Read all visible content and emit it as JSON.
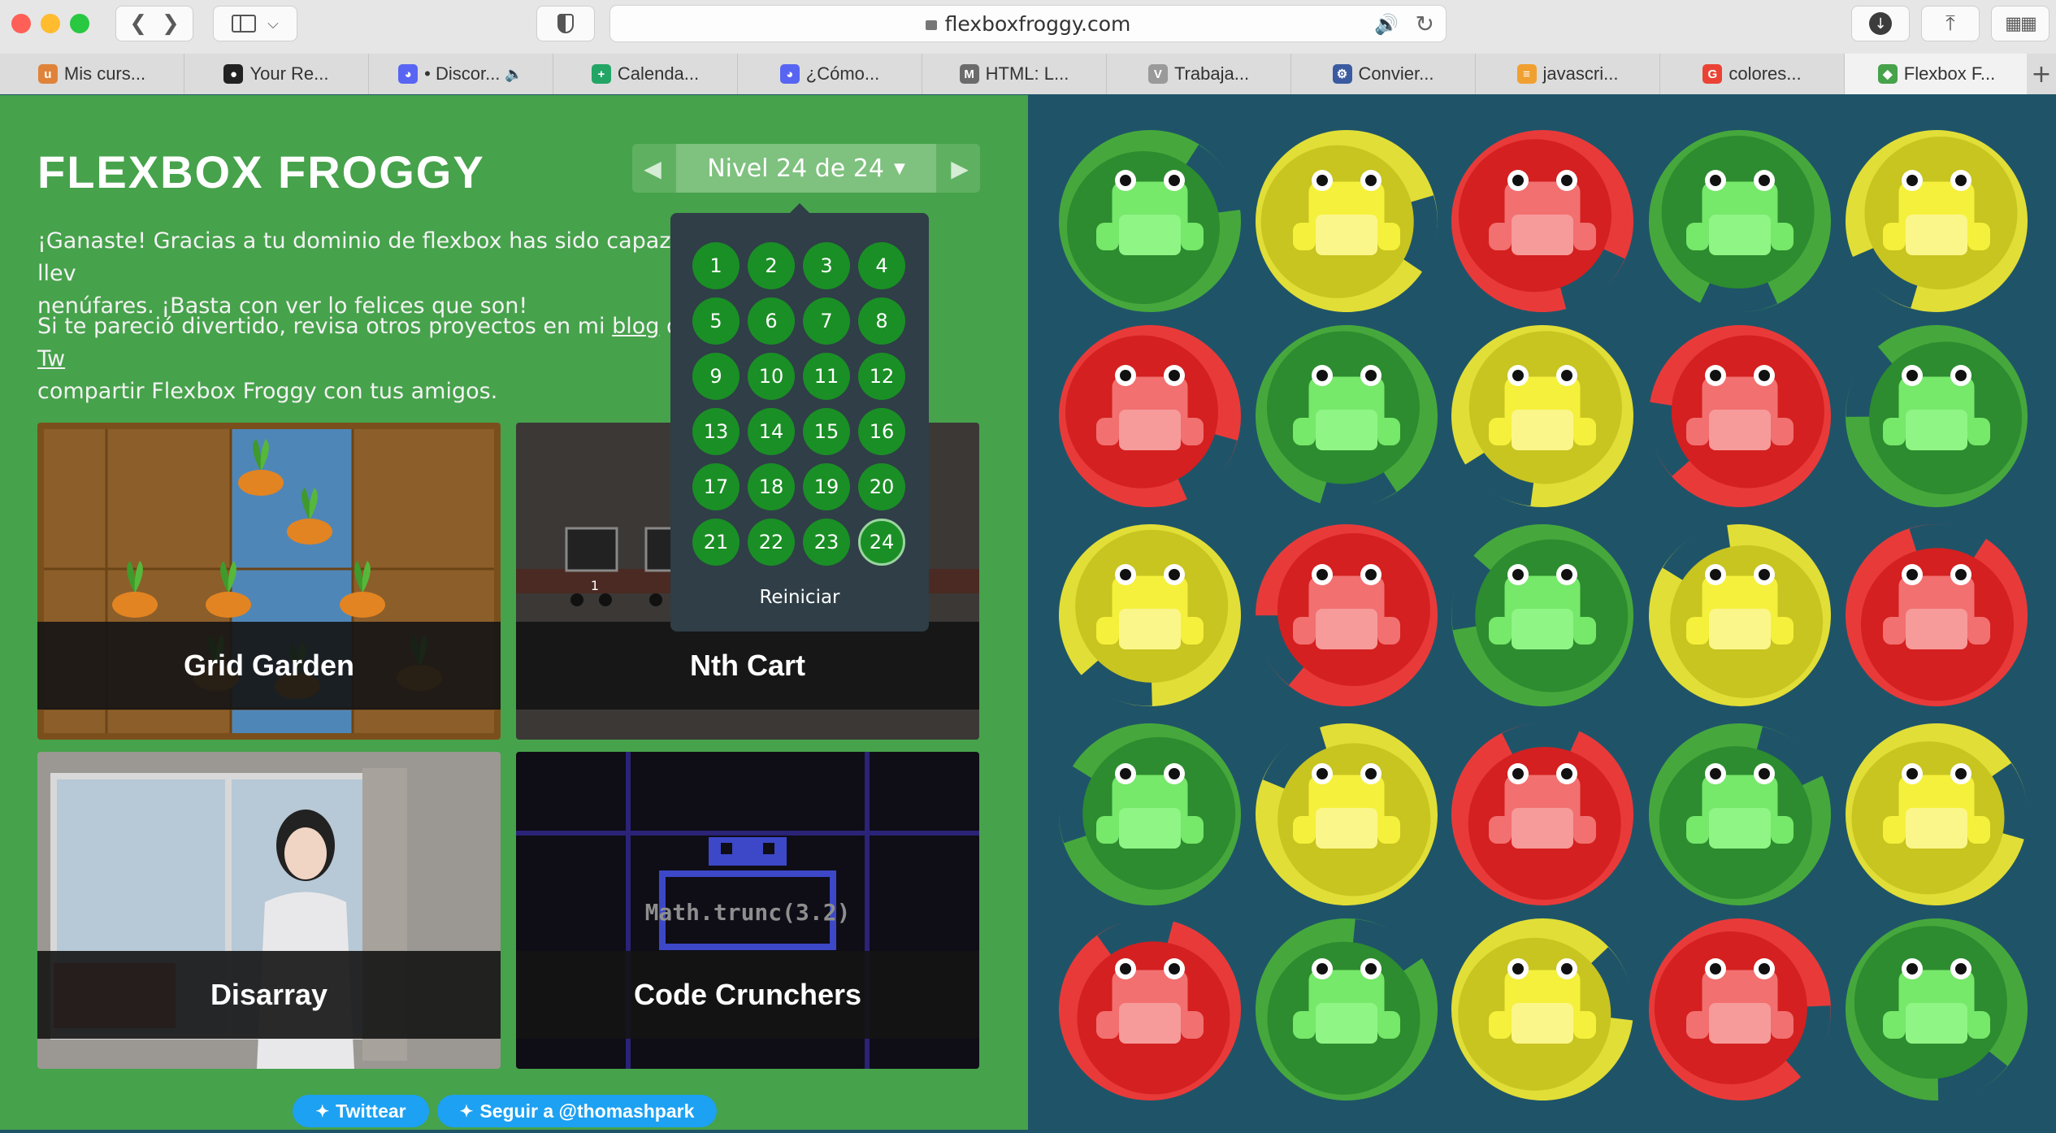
{
  "browser": {
    "url": "flexboxfroggy.com",
    "tabs": [
      {
        "label": "Mis curs...",
        "fav": "udemy",
        "color": "#e0833a"
      },
      {
        "label": "Your Re...",
        "fav": "github",
        "color": "#222222"
      },
      {
        "label": "• Discor...",
        "fav": "discord",
        "color": "#5865f2"
      },
      {
        "label": "Calenda...",
        "fav": "sheets",
        "color": "#23a566"
      },
      {
        "label": "¿Cómo...",
        "fav": "discord",
        "color": "#5865f2"
      },
      {
        "label": "HTML: L...",
        "fav": "M",
        "color": "#6b6b6b"
      },
      {
        "label": "Trabaja...",
        "fav": "V",
        "color": "#9a9a9a"
      },
      {
        "label": "Convier...",
        "fav": "gear",
        "color": "#3b5ba0"
      },
      {
        "label": "javascri...",
        "fav": "stack",
        "color": "#f0a030"
      },
      {
        "label": "colores...",
        "fav": "google",
        "color": "#ea4335"
      },
      {
        "label": "Flexbox F...",
        "fav": "frog",
        "color": "#46a24b"
      }
    ]
  },
  "game": {
    "title": "FLEXBOX FROGGY",
    "level_label": "Nivel 24 de 24",
    "win_text_1": "¡Ganaste! Gracias a tu dominio de flexbox has sido capaz llev",
    "win_text_2": "nenúfares. ¡Basta con ver lo felices que son!",
    "share_text_1a": "Si te pareció divertido, revisa otros proyectos en mi ",
    "share_link_blog": "blog",
    "share_text_1b": " o ",
    "share_link_tw": "Tw",
    "share_text_2": "compartir Flexbox Froggy con tus amigos.",
    "levels": [
      "1",
      "2",
      "3",
      "4",
      "5",
      "6",
      "7",
      "8",
      "9",
      "10",
      "11",
      "12",
      "13",
      "14",
      "15",
      "16",
      "17",
      "18",
      "19",
      "20",
      "21",
      "22",
      "23",
      "24"
    ],
    "current_level": "24",
    "reset_label": "Reiniciar",
    "cards": [
      "Grid Garden",
      "Nth Cart",
      "Disarray",
      "Code Crunchers"
    ],
    "code_snippet": "Math.trunc(3.2)",
    "twitter_button": "Twittear",
    "follow_button": "Seguir a @thomashpark"
  },
  "pond_colors": {
    "green_pad": "#2d8c2f",
    "green_pad_light": "#46a83c",
    "green_frog": "#76e86a",
    "yellow_pad": "#c8c420",
    "yellow_pad_light": "#e1de37",
    "yellow_frog": "#f5f03b",
    "red_pad": "#d42020",
    "red_pad_light": "#e93a3a",
    "red_frog": "#f27070"
  },
  "pond_grid": [
    [
      "green",
      "yellow",
      "red",
      "green",
      "yellow"
    ],
    [
      "red",
      "green",
      "yellow",
      "red",
      "green"
    ],
    [
      "yellow",
      "red",
      "green",
      "yellow",
      "red"
    ],
    [
      "green",
      "yellow",
      "red",
      "green",
      "yellow"
    ],
    [
      "red",
      "green",
      "yellow",
      "red",
      "green"
    ]
  ]
}
